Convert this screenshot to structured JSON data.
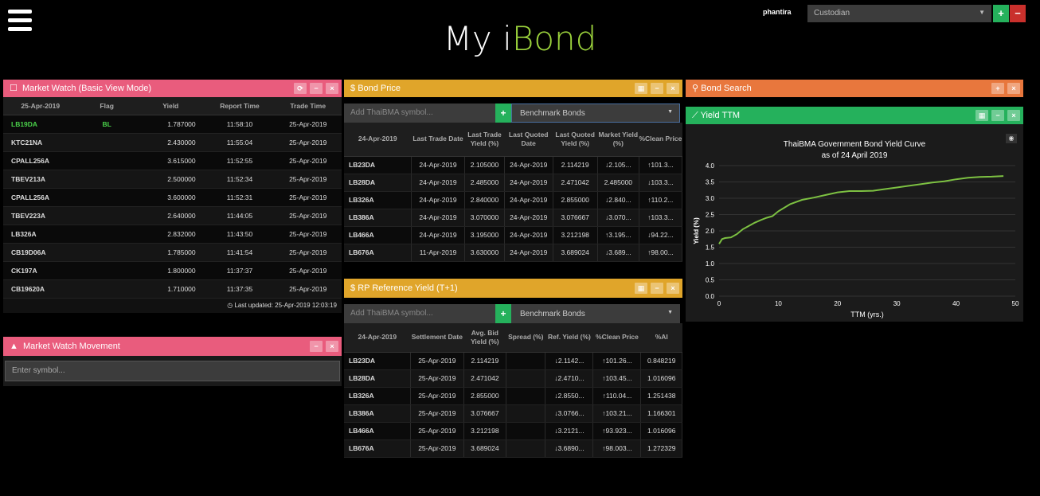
{
  "header": {
    "title_prefix": "My i",
    "title_brand": "Bond",
    "user": "phantira",
    "role": "Custodian",
    "brand_color": "#9bd23c"
  },
  "market_watch": {
    "title": "Market Watch (Basic View Mode)",
    "columns": [
      "25-Apr-2019",
      "Flag",
      "Yield",
      "Report Time",
      "Trade Time"
    ],
    "rows": [
      {
        "symbol": "LB19DA",
        "flag": "BL",
        "yield": "1.787000",
        "report": "11:58:10",
        "trade": "25-Apr-2019",
        "highlight": true
      },
      {
        "symbol": "KTC21NA",
        "flag": "",
        "yield": "2.430000",
        "report": "11:55:04",
        "trade": "25-Apr-2019"
      },
      {
        "symbol": "CPALL256A",
        "flag": "",
        "yield": "3.615000",
        "report": "11:52:55",
        "trade": "25-Apr-2019"
      },
      {
        "symbol": "TBEV213A",
        "flag": "",
        "yield": "2.500000",
        "report": "11:52:34",
        "trade": "25-Apr-2019"
      },
      {
        "symbol": "CPALL256A",
        "flag": "",
        "yield": "3.600000",
        "report": "11:52:31",
        "trade": "25-Apr-2019"
      },
      {
        "symbol": "TBEV223A",
        "flag": "",
        "yield": "2.640000",
        "report": "11:44:05",
        "trade": "25-Apr-2019"
      },
      {
        "symbol": "LB326A",
        "flag": "",
        "yield": "2.832000",
        "report": "11:43:50",
        "trade": "25-Apr-2019"
      },
      {
        "symbol": "CB19D06A",
        "flag": "",
        "yield": "1.785000",
        "report": "11:41:54",
        "trade": "25-Apr-2019"
      },
      {
        "symbol": "CK197A",
        "flag": "",
        "yield": "1.800000",
        "report": "11:37:37",
        "trade": "25-Apr-2019"
      },
      {
        "symbol": "CB19620A",
        "flag": "",
        "yield": "1.710000",
        "report": "11:37:35",
        "trade": "25-Apr-2019"
      }
    ],
    "last_updated": "Last updated: 25-Apr-2019 12:03:19"
  },
  "movement": {
    "title": "Market Watch Movement",
    "placeholder": "Enter symbol..."
  },
  "bond_price": {
    "title": "Bond Price",
    "placeholder": "Add ThaiBMA symbol...",
    "select": "Benchmark Bonds",
    "columns": [
      "24-Apr-2019",
      "Last Trade Date",
      "Last Trade Yield (%)",
      "Last Quoted Date",
      "Last Quoted Yield (%)",
      "Market Yield (%)",
      "%Clean Price"
    ],
    "rows": [
      {
        "s": "LB23DA",
        "ltd": "24-Apr-2019",
        "lty": "2.105000",
        "lqd": "24-Apr-2019",
        "lqy": "2.114219",
        "my": "2.105...",
        "my_dir": "down",
        "cp": "101.3...",
        "cp_dir": "up"
      },
      {
        "s": "LB28DA",
        "ltd": "24-Apr-2019",
        "lty": "2.485000",
        "lqd": "24-Apr-2019",
        "lqy": "2.471042",
        "my": "2.485000",
        "my_dir": "flat",
        "cp": "103.3...",
        "cp_dir": "down"
      },
      {
        "s": "LB326A",
        "ltd": "24-Apr-2019",
        "lty": "2.840000",
        "lqd": "24-Apr-2019",
        "lqy": "2.855000",
        "my": "2.840...",
        "my_dir": "down",
        "cp": "110.2...",
        "cp_dir": "up"
      },
      {
        "s": "LB386A",
        "ltd": "24-Apr-2019",
        "lty": "3.070000",
        "lqd": "24-Apr-2019",
        "lqy": "3.076667",
        "my": "3.070...",
        "my_dir": "down",
        "cp": "103.3...",
        "cp_dir": "up"
      },
      {
        "s": "LB466A",
        "ltd": "24-Apr-2019",
        "lty": "3.195000",
        "lqd": "24-Apr-2019",
        "lqy": "3.212198",
        "my": "3.195...",
        "my_dir": "up",
        "cp": "94.22...",
        "cp_dir": "down"
      },
      {
        "s": "LB676A",
        "ltd": "11-Apr-2019",
        "lty": "3.630000",
        "lqd": "24-Apr-2019",
        "lqy": "3.689024",
        "my": "3.689...",
        "my_dir": "down",
        "cp": "98.00...",
        "cp_dir": "up"
      }
    ]
  },
  "rp_yield": {
    "title": "RP Reference Yield (T+1)",
    "placeholder": "Add ThaiBMA symbol...",
    "select": "Benchmark Bonds",
    "columns": [
      "24-Apr-2019",
      "Settlement Date",
      "Avg. Bid Yield (%)",
      "Spread (%)",
      "Ref. Yield (%)",
      "%Clean Price",
      "%AI"
    ],
    "rows": [
      {
        "s": "LB23DA",
        "sd": "25-Apr-2019",
        "aby": "2.114219",
        "sp": "",
        "ry": "2.1142...",
        "cp": "101.26...",
        "ai": "0.848219"
      },
      {
        "s": "LB28DA",
        "sd": "25-Apr-2019",
        "aby": "2.471042",
        "sp": "",
        "ry": "2.4710...",
        "cp": "103.45...",
        "ai": "1.016096"
      },
      {
        "s": "LB326A",
        "sd": "25-Apr-2019",
        "aby": "2.855000",
        "sp": "",
        "ry": "2.8550...",
        "cp": "110.04...",
        "ai": "1.251438"
      },
      {
        "s": "LB386A",
        "sd": "25-Apr-2019",
        "aby": "3.076667",
        "sp": "",
        "ry": "3.0766...",
        "cp": "103.21...",
        "ai": "1.166301"
      },
      {
        "s": "LB466A",
        "sd": "25-Apr-2019",
        "aby": "3.212198",
        "sp": "",
        "ry": "3.2121...",
        "cp": "93.923...",
        "ai": "1.016096"
      },
      {
        "s": "LB676A",
        "sd": "25-Apr-2019",
        "aby": "3.689024",
        "sp": "",
        "ry": "3.6890...",
        "cp": "98.003...",
        "ai": "1.272329"
      }
    ]
  },
  "bond_search": {
    "title": "Bond Search"
  },
  "yield_ttm": {
    "title": "Yield TTM"
  },
  "chart_data": {
    "type": "line",
    "title": "ThaiBMA Government Bond Yield Curve",
    "subtitle": "as of 24 April 2019",
    "xlabel": "TTM (yrs.)",
    "ylabel": "Yield (%)",
    "xlim": [
      0,
      50
    ],
    "ylim": [
      0,
      4.0
    ],
    "xticks": [
      "0",
      "10",
      "20",
      "30",
      "40",
      "50"
    ],
    "yticks": [
      "0.0",
      "0.5",
      "1.0",
      "1.5",
      "2.0",
      "2.5",
      "3.0",
      "3.5",
      "4.0"
    ],
    "line_color": "#7dc142",
    "x": [
      0,
      0.5,
      1,
      2,
      3,
      4,
      5,
      6,
      7,
      8,
      9,
      10,
      12,
      14,
      16,
      18,
      20,
      22,
      24,
      26,
      28,
      30,
      32,
      34,
      36,
      38,
      40,
      42,
      44,
      46,
      48
    ],
    "y": [
      1.6,
      1.75,
      1.78,
      1.8,
      1.9,
      2.05,
      2.15,
      2.25,
      2.33,
      2.4,
      2.45,
      2.6,
      2.82,
      2.95,
      3.02,
      3.1,
      3.18,
      3.22,
      3.22,
      3.23,
      3.28,
      3.33,
      3.38,
      3.43,
      3.48,
      3.52,
      3.58,
      3.63,
      3.65,
      3.66,
      3.68
    ]
  }
}
